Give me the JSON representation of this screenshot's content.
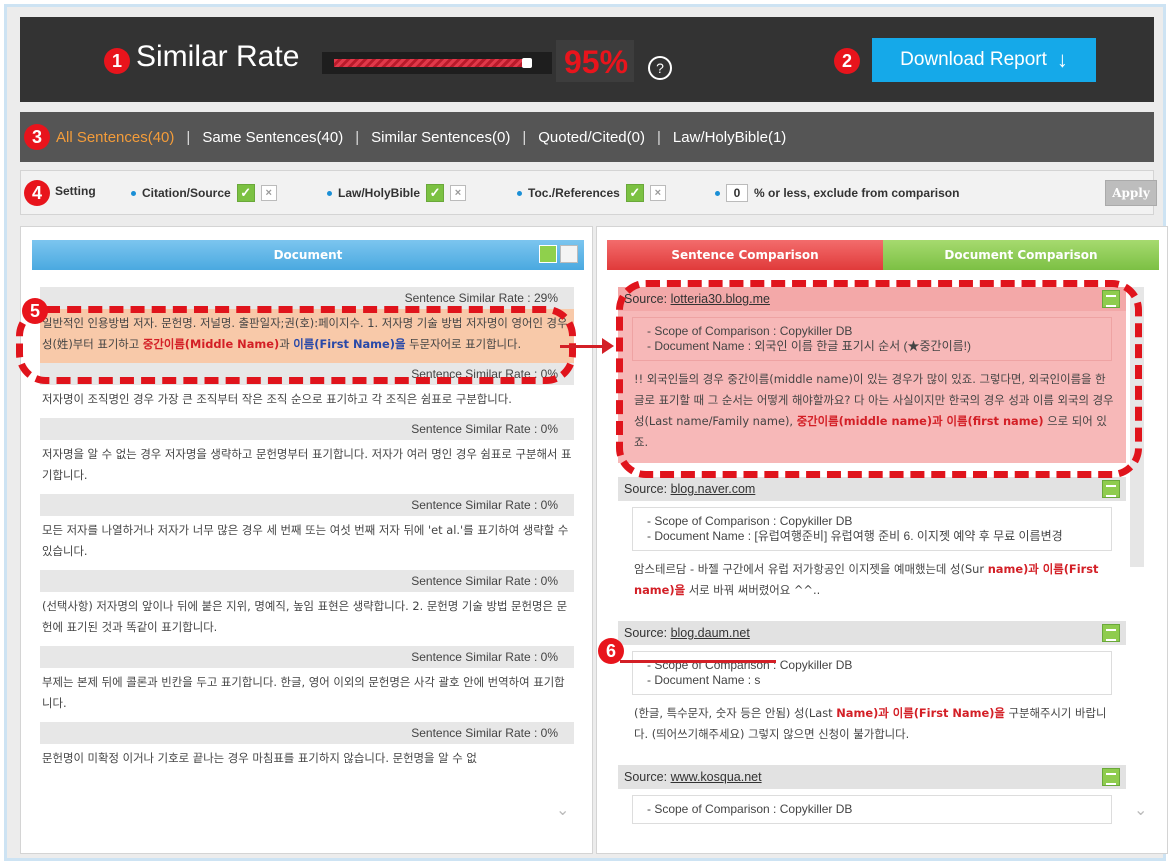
{
  "markers": [
    "1",
    "2",
    "3",
    "4",
    "5",
    "6"
  ],
  "header": {
    "similar_rate_label": "Similar Rate",
    "similar_rate_value": 95,
    "similar_rate_text": "95%",
    "help_symbol": "?",
    "download_label": "Download Report",
    "download_icon": "↓"
  },
  "tabs": [
    {
      "label": "All Sentences(40)",
      "active": true
    },
    {
      "label": "Same Sentences(40)",
      "active": false
    },
    {
      "label": "Similar Sentences(0)",
      "active": false
    },
    {
      "label": "Quoted/Cited(0)",
      "active": false
    },
    {
      "label": "Law/HolyBible(1)",
      "active": false
    }
  ],
  "tab_separator": "|",
  "settings": {
    "label": "Setting",
    "items": [
      {
        "label": "Citation/Source",
        "checked": true
      },
      {
        "label": "Law/HolyBible",
        "checked": true
      },
      {
        "label": "Toc./References",
        "checked": true
      }
    ],
    "threshold_value": "0",
    "threshold_label": "% or less, exclude from comparison",
    "apply_label": "Apply",
    "check_mark": "✓",
    "x_mark": "×"
  },
  "document_panel": {
    "title": "Document",
    "sentences": [
      {
        "rate": "Sentence Similar Rate : 29%",
        "text_pre": "일반적인 인용방법 저자. 문헌명. 저널명. 출판일자;권(호):페이지수. 1. 저자명 기술 방법 저자명이 영어인 경우 성(姓)부터 표기하고 ",
        "text_hl_red": "중간이름(Middle Name)",
        "text_mid": "과 ",
        "text_hl_blue": "이름(First Name)을",
        "text_post": " 두문자어로 표기합니다.",
        "highlight": true
      },
      {
        "rate": "Sentence Similar Rate : 0%",
        "text": "저자명이 조직명인 경우 가장 큰 조직부터 작은 조직 순으로 표기하고 각 조직은 쉼표로 구분합니다."
      },
      {
        "rate": "Sentence Similar Rate : 0%",
        "text": "저자명을 알 수 없는 경우 저자명을 생략하고 문헌명부터 표기합니다. 저자가 여러 명인 경우 쉼표로 구분해서 표기합니다."
      },
      {
        "rate": "Sentence Similar Rate : 0%",
        "text": "모든 저자를 나열하거나 저자가 너무 많은 경우 세 번째 또는 여섯 번째 저자 뒤에 'et al.'를 표기하여 생략할 수 있습니다."
      },
      {
        "rate": "Sentence Similar Rate : 0%",
        "text": "(선택사항) 저자명의 앞이나 뒤에 붙은 지위, 명예직, 높임 표현은 생략합니다. 2. 문헌명 기술 방법 문헌명은 문헌에 표기된 것과 똑같이 표기합니다."
      },
      {
        "rate": "Sentence Similar Rate : 0%",
        "text": "부제는 본제 뒤에 콜론과 빈칸을 두고 표기합니다. 한글, 영어 이외의 문헌명은 사각 괄호 안에 번역하여 표기합니다."
      },
      {
        "rate": "Sentence Similar Rate : 0%",
        "text": "문헌명이 미확정 이거나 기호로 끝나는 경우 마침표를 표기하지 않습니다. 문헌명을 알 수 없"
      }
    ]
  },
  "compare_panel": {
    "tab_sentence": "Sentence Comparison",
    "tab_document": "Document Comparison",
    "source_label": "Source: ",
    "sources": [
      {
        "name": "lotteria30.blog.me",
        "scope": "- Scope of Comparison : Copykiller DB",
        "doc": "- Document Name : 외국인 이름 한글 표기시 순서 (★중간이름!)",
        "text_pre": "!! 외국인들의 경우 중간이름(middle name)이 있는 경우가 많이 있죠. 그렇다면, 외국인이름을 한글로 표기할 때 그 순서는 어떻게 해야할까요? 다 아는 사실이지만 한국의 경우 성과 이름 외국의 경우 성(Last name/Family name), ",
        "text_hl": "중간이름(middle name)과 이름(first name)",
        "text_post": " 으로 되어 있죠.",
        "highlight": true
      },
      {
        "name": "blog.naver.com",
        "scope": "- Scope of Comparison : Copykiller DB",
        "doc": "- Document Name : [유럽여행준비] 유럽여행 준비 6. 이지젯 예약 후 무료 이름변경",
        "text_pre": "암스테르담 - 바젤 구간에서 유럽 저가항공인 이지젯을 예매했는데 성(Sur ",
        "text_hl": "name)과 이름(First name)을",
        "text_post": " 서로 바꿔 써버렸어요 ^^.."
      },
      {
        "name": "blog.daum.net",
        "scope": "- Scope of Comparison : Copykiller DB",
        "doc": "- Document Name : s",
        "text_pre": "(한글, 특수문자, 숫자 등은 안됨) 성(Last ",
        "text_hl": "Name)과 이름(First Name)을",
        "text_post": " 구분해주시기 바랍니다. (띄어쓰기해주세요) 그렇지 않으면 신청이 불가합니다."
      },
      {
        "name": "www.kosqua.net",
        "scope": "- Scope of Comparison : Copykiller DB",
        "doc": "",
        "text_pre": "",
        "text_hl": "",
        "text_post": ""
      }
    ]
  },
  "scroll_icon": "chevron-down-icon",
  "colors": {
    "accent_red": "#e8141c",
    "download_blue": "#15a9e9",
    "active_tab": "#f39c3a",
    "check_green": "#7bc142"
  }
}
